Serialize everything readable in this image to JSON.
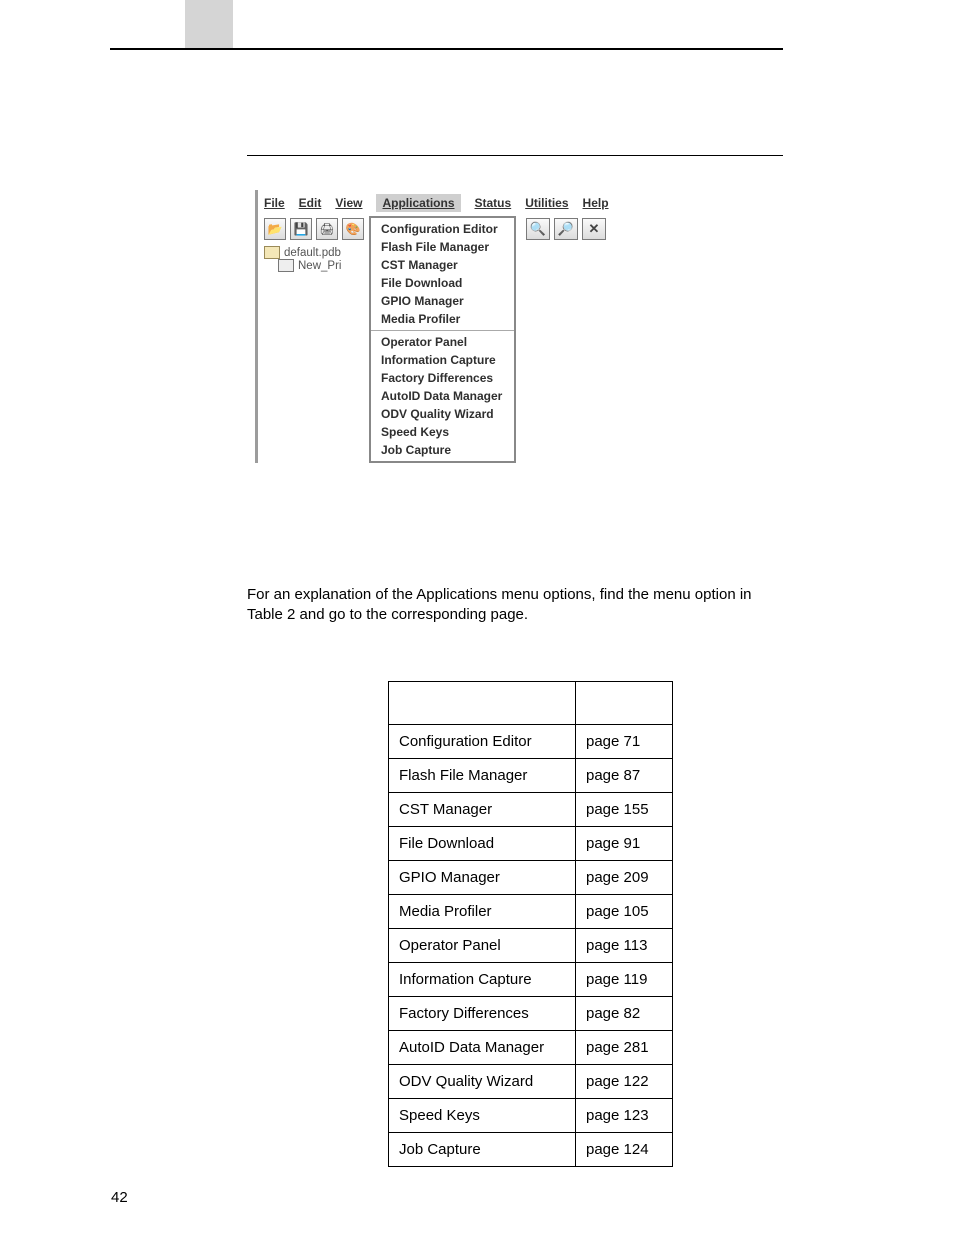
{
  "menubar": {
    "file": "File",
    "edit": "Edit",
    "view": "View",
    "applications": "Applications",
    "status": "Status",
    "utilities": "Utilities",
    "help": "Help"
  },
  "tree": {
    "root": "default.pdb",
    "child": "New_Pri"
  },
  "dropdown": {
    "group1": [
      "Configuration Editor",
      "Flash File Manager",
      "CST Manager",
      "File Download",
      "GPIO Manager",
      "Media Profiler"
    ],
    "group2": [
      "Operator Panel",
      "Information Capture",
      "Factory Differences",
      "AutoID Data Manager",
      "ODV Quality Wizard",
      "Speed Keys",
      "Job Capture"
    ]
  },
  "body_text": "For an explanation of the Applications menu options, find the menu option in Table 2 and go to the corresponding page.",
  "chart_data": {
    "type": "table",
    "headers": [
      "",
      ""
    ],
    "rows": [
      [
        "Configuration Editor",
        "page 71"
      ],
      [
        "Flash File Manager",
        "page 87"
      ],
      [
        "CST Manager",
        "page 155"
      ],
      [
        "File Download",
        "page 91"
      ],
      [
        "GPIO Manager",
        "page 209"
      ],
      [
        "Media Profiler",
        "page 105"
      ],
      [
        "Operator Panel",
        "page 113"
      ],
      [
        "Information Capture",
        "page 119"
      ],
      [
        "Factory Differences",
        "page 82"
      ],
      [
        "AutoID Data Manager",
        "page 281"
      ],
      [
        "ODV Quality Wizard",
        "page 122"
      ],
      [
        "Speed Keys",
        "page 123"
      ],
      [
        "Job Capture",
        "page 124"
      ]
    ]
  },
  "page_number": "42"
}
